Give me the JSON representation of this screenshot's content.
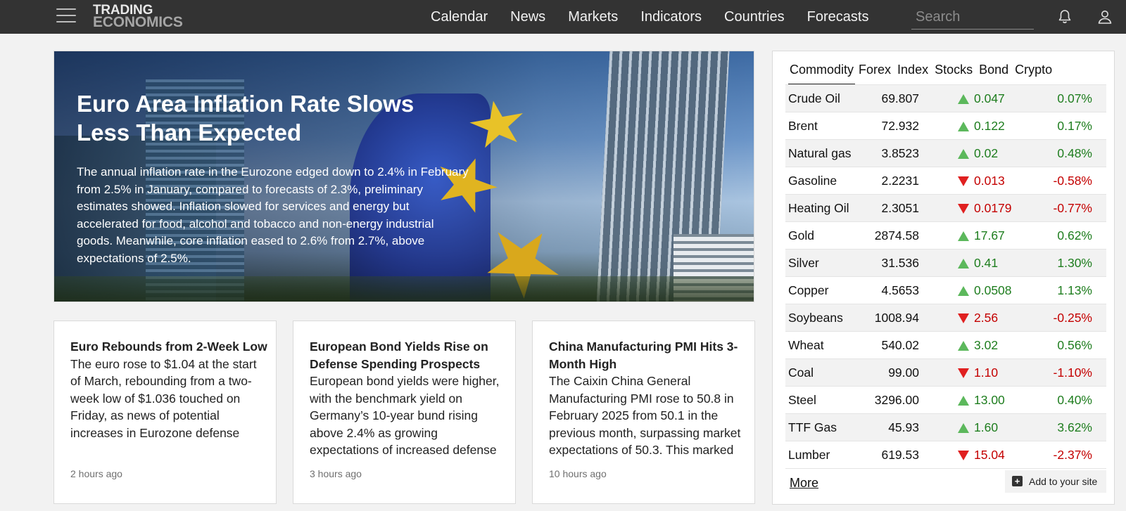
{
  "navbar": {
    "logo_line1": "TRADING",
    "logo_line2": "ECONOMICS",
    "links": [
      "Calendar",
      "News",
      "Markets",
      "Indicators",
      "Countries",
      "Forecasts"
    ],
    "search_placeholder": "Search"
  },
  "hero": {
    "title": "Euro Area Inflation Rate Slows Less Than Expected",
    "summary": "The annual inflation rate in the Eurozone edged down to 2.4% in February from 2.5% in January, compared to forecasts of 2.3%, preliminary estimates showed. Inflation slowed for services and energy but accelerated for food, alcohol and tobacco and non-energy industrial goods. Meanwhile, core inflation eased to 2.6% from 2.7%, above expectations of 2.5%."
  },
  "cards": [
    {
      "title": "Euro Rebounds from 2-Week Low",
      "text": "The euro rose to $1.04 at the start of March, rebounding from a two-week low of $1.036 touched on Friday, as news of potential increases in Eurozone defense",
      "time": "2 hours ago"
    },
    {
      "title": "European Bond Yields Rise on Defense Spending Prospects",
      "text": "European bond yields were higher, with the benchmark yield on Germany’s 10-year bund rising above 2.4% as growing expectations of increased defense",
      "time": "3 hours ago"
    },
    {
      "title": "China Manufacturing PMI Hits 3-Month High",
      "text": "The Caixin China General Manufacturing PMI rose to 50.8 in February 2025 from 50.1 in the previous month, surpassing market expectations of 50.3. This marked",
      "time": "10 hours ago"
    }
  ],
  "markets": {
    "tabs": [
      "Commodity",
      "Forex",
      "Index",
      "Stocks",
      "Bond",
      "Crypto"
    ],
    "active_tab": "Commodity",
    "colors": {
      "up": "#1e7d1e",
      "down": "#c40000",
      "up_arrow": "#5cb85c",
      "down_arrow": "#e02020"
    },
    "rows": [
      {
        "name": "Crude Oil",
        "price": "69.807",
        "change": "0.047",
        "pct": "0.07%",
        "dir": "up"
      },
      {
        "name": "Brent",
        "price": "72.932",
        "change": "0.122",
        "pct": "0.17%",
        "dir": "up"
      },
      {
        "name": "Natural gas",
        "price": "3.8523",
        "change": "0.02",
        "pct": "0.48%",
        "dir": "up"
      },
      {
        "name": "Gasoline",
        "price": "2.2231",
        "change": "0.013",
        "pct": "-0.58%",
        "dir": "down"
      },
      {
        "name": "Heating Oil",
        "price": "2.3051",
        "change": "0.0179",
        "pct": "-0.77%",
        "dir": "down"
      },
      {
        "name": "Gold",
        "price": "2874.58",
        "change": "17.67",
        "pct": "0.62%",
        "dir": "up"
      },
      {
        "name": "Silver",
        "price": "31.536",
        "change": "0.41",
        "pct": "1.30%",
        "dir": "up"
      },
      {
        "name": "Copper",
        "price": "4.5653",
        "change": "0.0508",
        "pct": "1.13%",
        "dir": "up"
      },
      {
        "name": "Soybeans",
        "price": "1008.94",
        "change": "2.56",
        "pct": "-0.25%",
        "dir": "down"
      },
      {
        "name": "Wheat",
        "price": "540.02",
        "change": "3.02",
        "pct": "0.56%",
        "dir": "up"
      },
      {
        "name": "Coal",
        "price": "99.00",
        "change": "1.10",
        "pct": "-1.10%",
        "dir": "down"
      },
      {
        "name": "Steel",
        "price": "3296.00",
        "change": "13.00",
        "pct": "0.40%",
        "dir": "up"
      },
      {
        "name": "TTF Gas",
        "price": "45.93",
        "change": "1.60",
        "pct": "3.62%",
        "dir": "up"
      },
      {
        "name": "Lumber",
        "price": "619.53",
        "change": "15.04",
        "pct": "-2.37%",
        "dir": "down"
      }
    ],
    "more_label": "More",
    "add_label": "Add to your site"
  }
}
